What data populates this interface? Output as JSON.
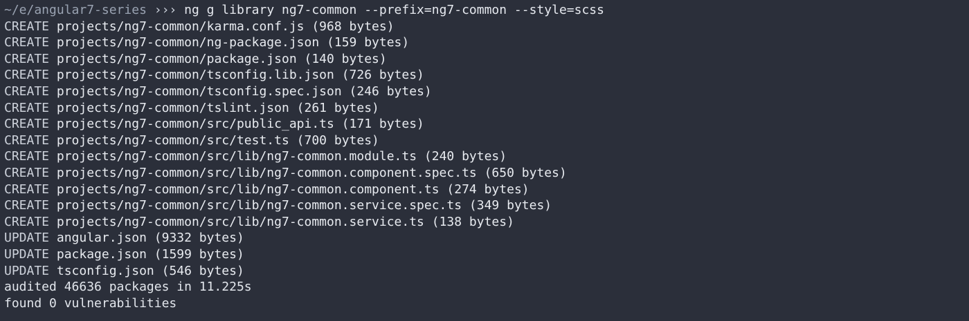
{
  "colors": {
    "background": "#2b2f3a",
    "text": "#dfe3ea",
    "prompt_path": "#9aa3b2"
  },
  "prompt": {
    "path": "~/e/angular7-series",
    "arrows": "›››",
    "command": "ng g library ng7-common --prefix=ng7-common --style=scss"
  },
  "output": [
    {
      "action": "CREATE",
      "path": "projects/ng7-common/karma.conf.js",
      "size": "(968 bytes)"
    },
    {
      "action": "CREATE",
      "path": "projects/ng7-common/ng-package.json",
      "size": "(159 bytes)"
    },
    {
      "action": "CREATE",
      "path": "projects/ng7-common/package.json",
      "size": "(140 bytes)"
    },
    {
      "action": "CREATE",
      "path": "projects/ng7-common/tsconfig.lib.json",
      "size": "(726 bytes)"
    },
    {
      "action": "CREATE",
      "path": "projects/ng7-common/tsconfig.spec.json",
      "size": "(246 bytes)"
    },
    {
      "action": "CREATE",
      "path": "projects/ng7-common/tslint.json",
      "size": "(261 bytes)"
    },
    {
      "action": "CREATE",
      "path": "projects/ng7-common/src/public_api.ts",
      "size": "(171 bytes)"
    },
    {
      "action": "CREATE",
      "path": "projects/ng7-common/src/test.ts",
      "size": "(700 bytes)"
    },
    {
      "action": "CREATE",
      "path": "projects/ng7-common/src/lib/ng7-common.module.ts",
      "size": "(240 bytes)"
    },
    {
      "action": "CREATE",
      "path": "projects/ng7-common/src/lib/ng7-common.component.spec.ts",
      "size": "(650 bytes)"
    },
    {
      "action": "CREATE",
      "path": "projects/ng7-common/src/lib/ng7-common.component.ts",
      "size": "(274 bytes)"
    },
    {
      "action": "CREATE",
      "path": "projects/ng7-common/src/lib/ng7-common.service.spec.ts",
      "size": "(349 bytes)"
    },
    {
      "action": "CREATE",
      "path": "projects/ng7-common/src/lib/ng7-common.service.ts",
      "size": "(138 bytes)"
    },
    {
      "action": "UPDATE",
      "path": "angular.json",
      "size": "(9332 bytes)"
    },
    {
      "action": "UPDATE",
      "path": "package.json",
      "size": "(1599 bytes)"
    },
    {
      "action": "UPDATE",
      "path": "tsconfig.json",
      "size": "(546 bytes)"
    }
  ],
  "summary": [
    "audited 46636 packages in 11.225s",
    "found 0 vulnerabilities"
  ]
}
